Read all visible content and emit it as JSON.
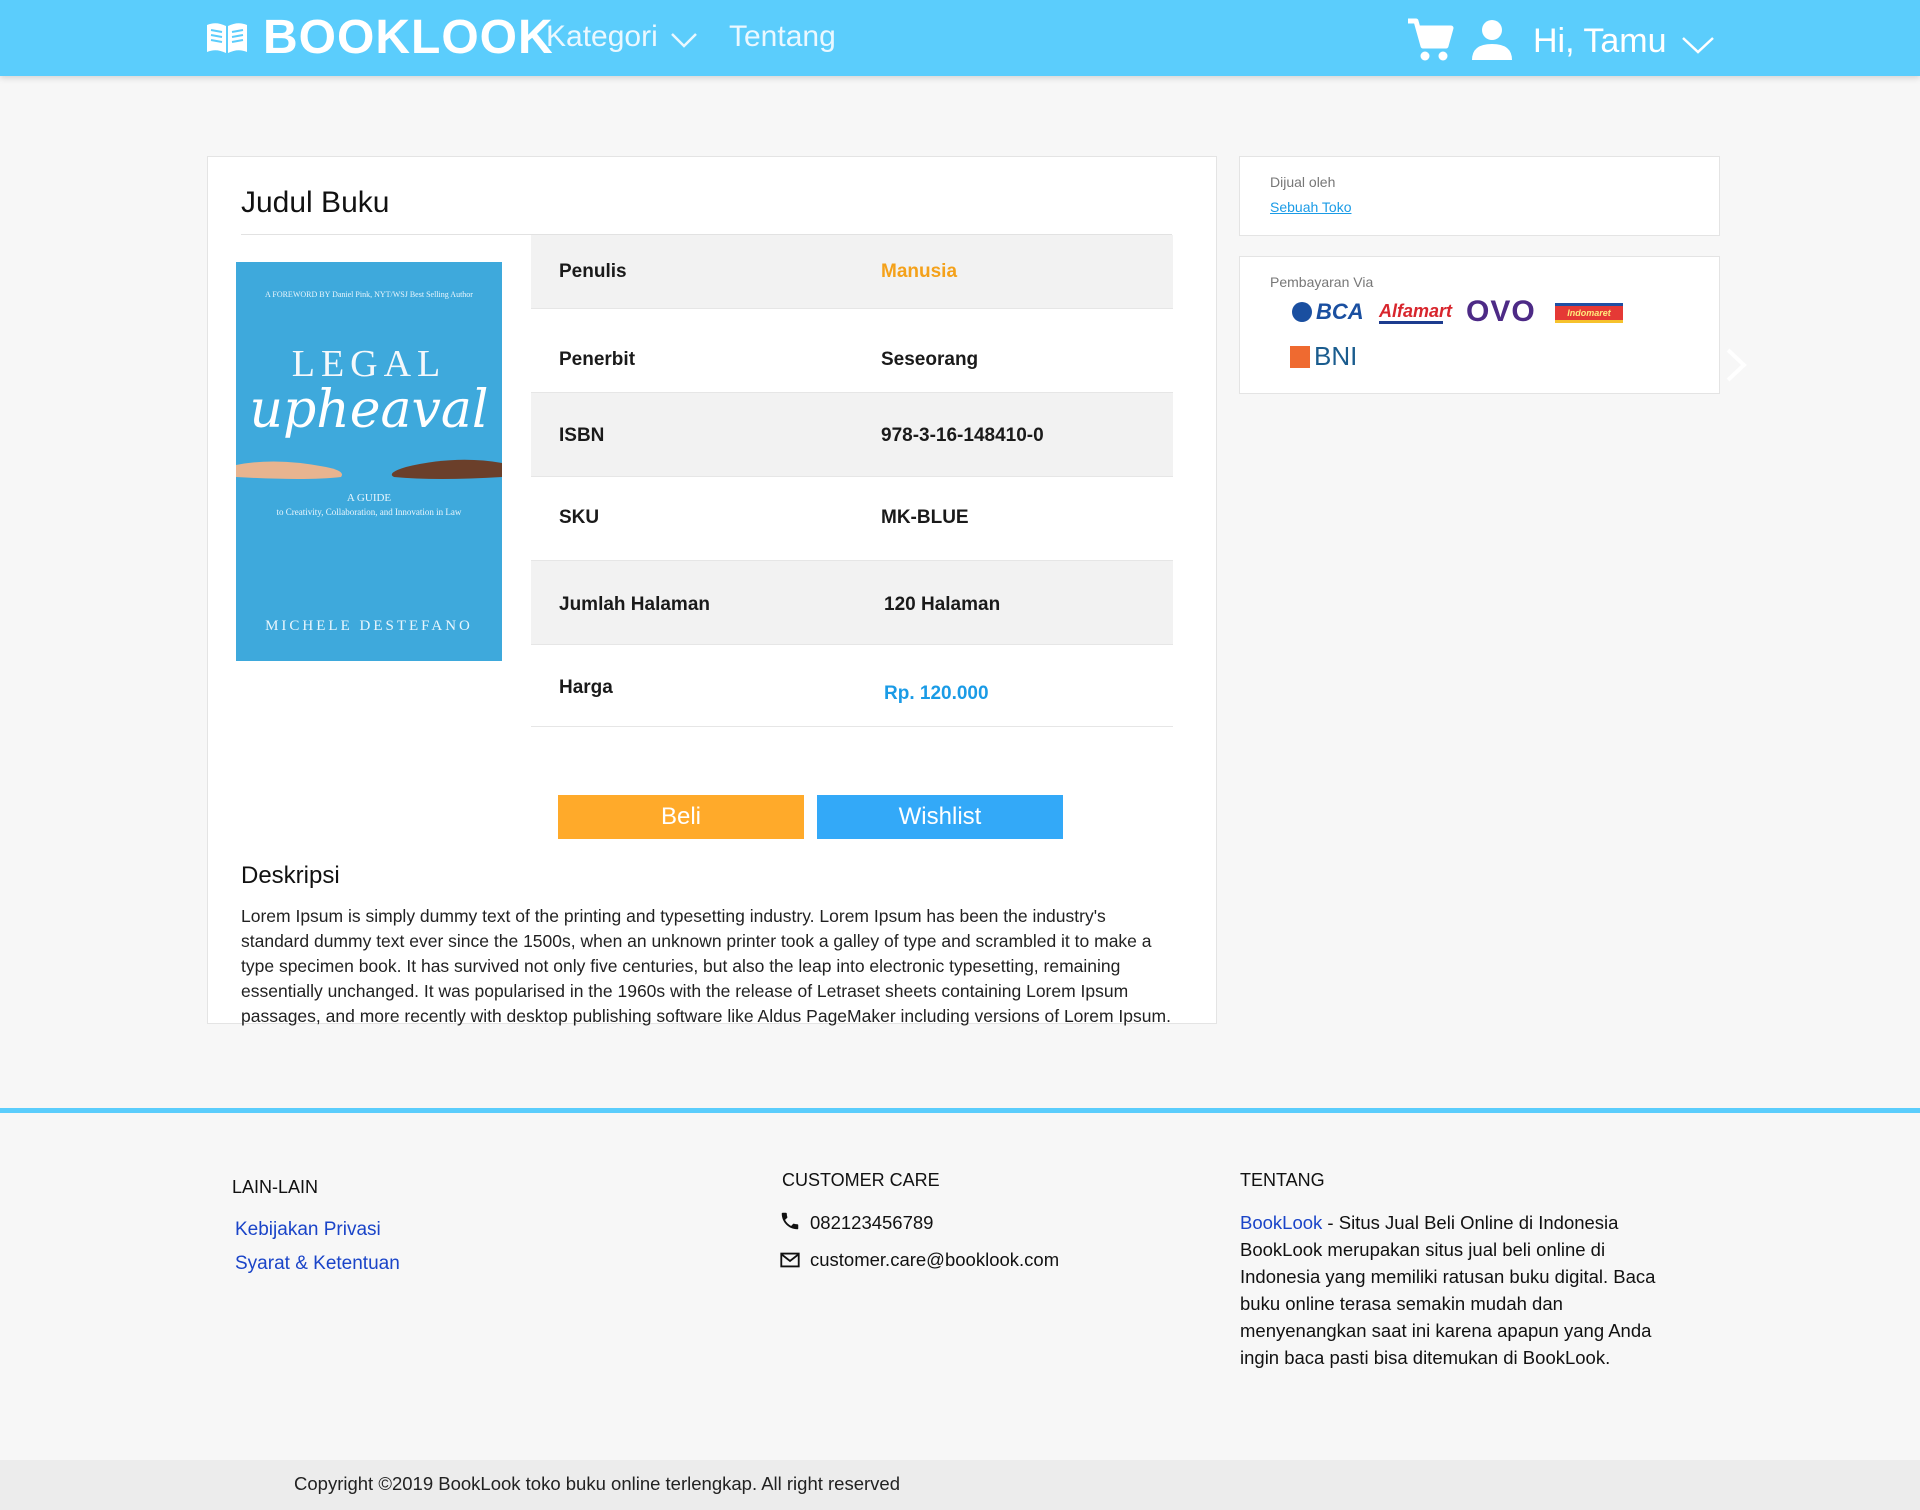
{
  "header": {
    "brand": "BOOKLOOK",
    "nav_kategori": "Kategori",
    "nav_tentang": "Tentang",
    "greeting": "Hi, Tamu",
    "icons": [
      "book-icon",
      "chevron-down-icon",
      "cart-icon",
      "user-icon"
    ]
  },
  "book": {
    "title": "Judul Buku",
    "cover": {
      "foreword": "A FOREWORD BY Daniel Pink, NYT/WSJ Best Selling Author",
      "title_line1": "LEGAL",
      "title_line2": "upheaval",
      "subtitle1": "A GUIDE",
      "subtitle2": "to Creativity, Collaboration, and Innovation in Law",
      "author": "MICHELE DESTEFANO"
    },
    "details": [
      {
        "key": "Penulis",
        "value": "Manusia"
      },
      {
        "key": "Penerbit",
        "value": "Seseorang"
      },
      {
        "key": "ISBN",
        "value": "978-3-16-148410-0"
      },
      {
        "key": "SKU",
        "value": "MK-BLUE"
      },
      {
        "key": "Jumlah Halaman",
        "value": "120 Halaman"
      },
      {
        "key": "Harga",
        "value": "Rp. 120.000"
      }
    ],
    "buttons": {
      "beli": "Beli",
      "wishlist": "Wishlist"
    },
    "description_title": "Deskripsi",
    "description": "Lorem Ipsum is simply dummy text of the printing and typesetting industry. Lorem Ipsum has been the industry's standard dummy text ever since the 1500s, when an unknown printer took a galley of type and scrambled it to make a type specimen book. It has survived not only five centuries, but also the leap into electronic typesetting, remaining essentially unchanged. It was popularised in the 1960s with the release of Letraset sheets containing Lorem Ipsum passages, and more recently with desktop publishing software like Aldus PageMaker including versions of Lorem Ipsum."
  },
  "seller": {
    "label": "Dijual oleh",
    "name": "Sebuah Toko"
  },
  "payment": {
    "label": "Pembayaran Via",
    "methods": [
      "BCA",
      "Alfamart",
      "OVO",
      "Indomaret",
      "BNI"
    ]
  },
  "footer": {
    "lain_title": "LAIN-LAIN",
    "lain_links": [
      "Kebijakan Privasi",
      "Syarat & Ketentuan"
    ],
    "care_title": "CUSTOMER CARE",
    "phone": "082123456789",
    "email": "customer.care@booklook.com",
    "tentang_title": "TENTANG",
    "about_brand": "BookLook",
    "about_text": " - Situs Jual Beli Online di Indonesia BookLook merupakan situs jual beli online di Indonesia yang memiliki ratusan buku digital. Baca buku online terasa semakin mudah dan menyenangkan saat ini karena apapun yang Anda ingin baca pasti bisa ditemukan di BookLook.",
    "copyright": "Copyright ©2019 BookLook toko buku online terlengkap. All right reserved"
  },
  "colors": {
    "header_bg": "#5bcdfc",
    "beli_button": "#ffaa2a",
    "wishlist_button": "#33a9f8",
    "author_value": "#f4a11a",
    "price_value": "#1a9be6",
    "footer_link": "#1a44c8"
  }
}
